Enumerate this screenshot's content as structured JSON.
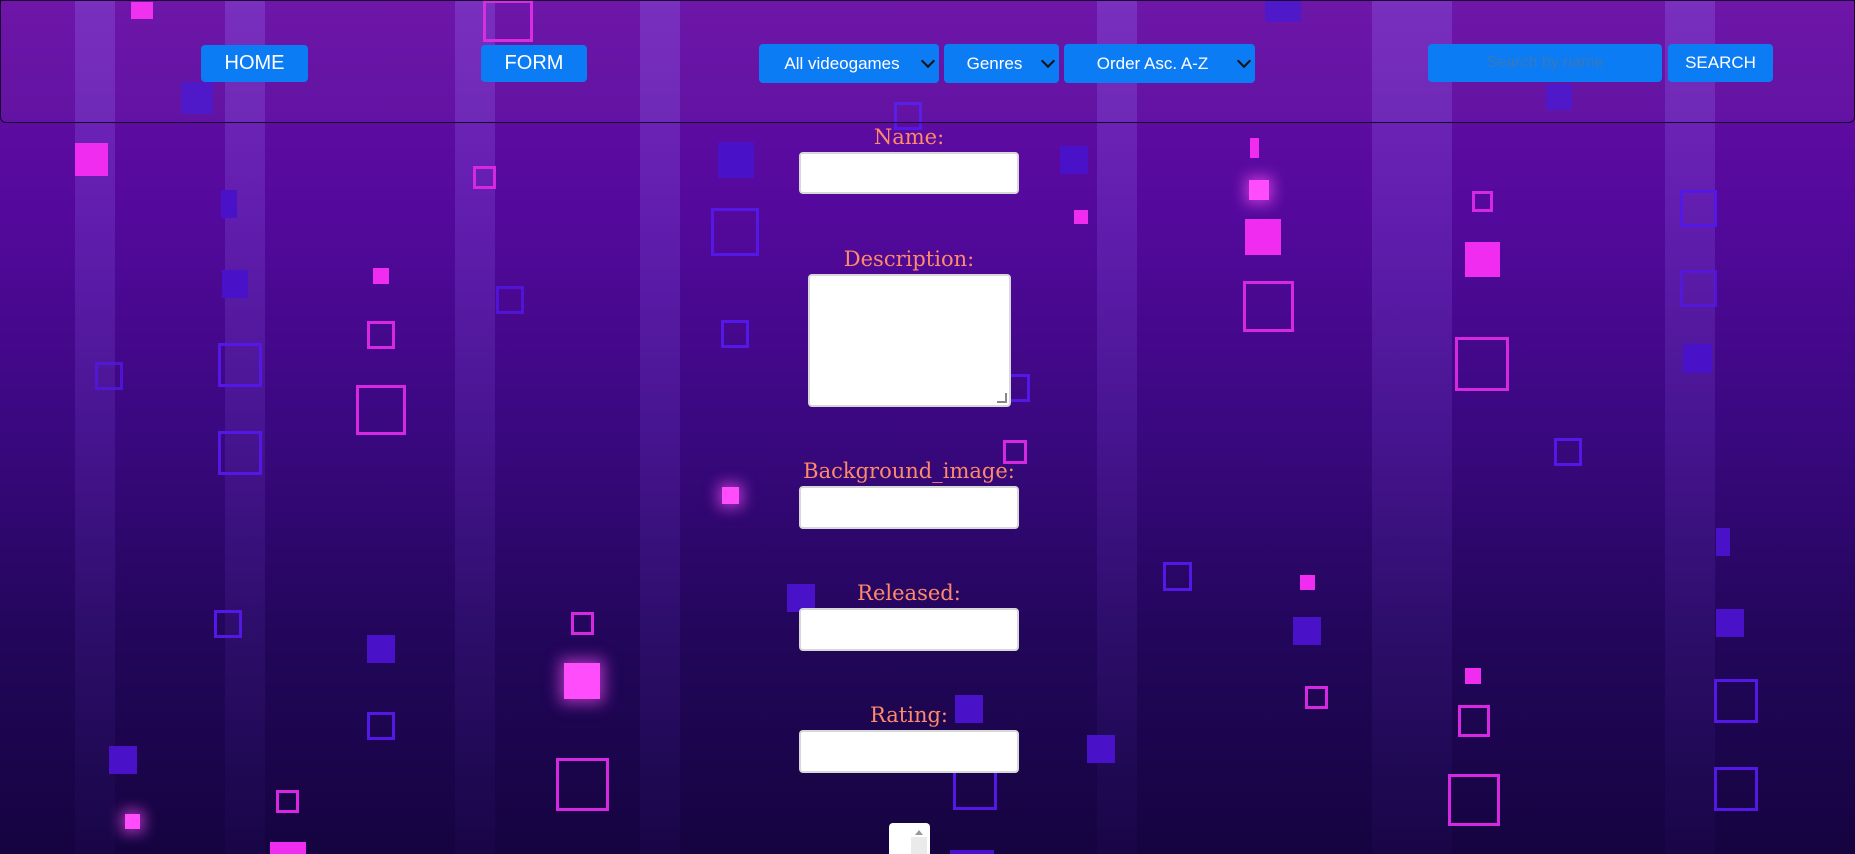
{
  "navbar": {
    "home_label": "HOME",
    "form_label": "FORM",
    "filter_select": {
      "selected": "All videogames"
    },
    "genres_select": {
      "selected": "Genres"
    },
    "order_select": {
      "selected": "Order Asc. A-Z"
    },
    "search": {
      "placeholder": "Search by name",
      "button_label": "SEARCH"
    }
  },
  "form": {
    "name_label": "Name:",
    "description_label": "Description:",
    "background_image_label": "Background_image:",
    "released_label": "Released:",
    "rating_label": "Rating:"
  },
  "colors": {
    "accent_button": "#0c7cf4",
    "label_text": "#ff8a6a",
    "background_top": "#6a0fa6",
    "background_bottom": "#150440"
  }
}
